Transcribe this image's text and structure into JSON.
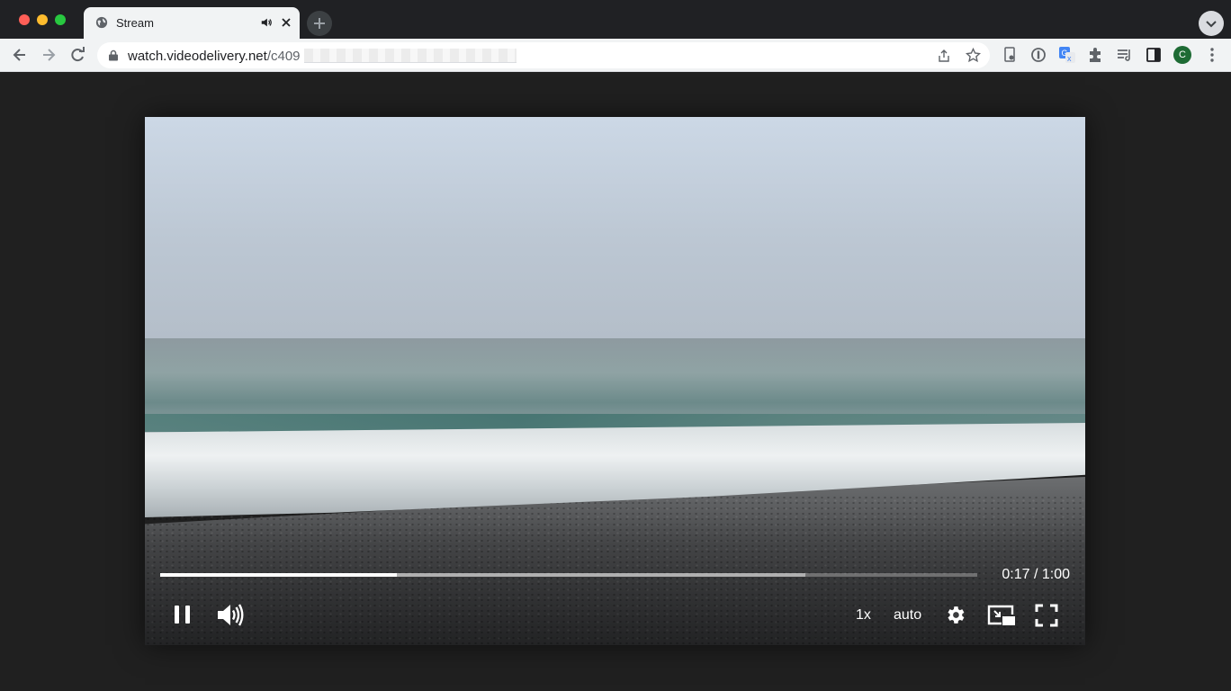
{
  "browser": {
    "tab": {
      "title": "Stream"
    },
    "address_bar": {
      "host": "watch.videodelivery.net",
      "path": "/c409"
    },
    "profile_initial": "C"
  },
  "player": {
    "current_time": "0:17",
    "duration": "1:00",
    "time_separator": " / ",
    "progress_fraction": 0.29,
    "buffered_fraction": 0.79,
    "speed_label": "1x",
    "quality_label": "auto"
  }
}
